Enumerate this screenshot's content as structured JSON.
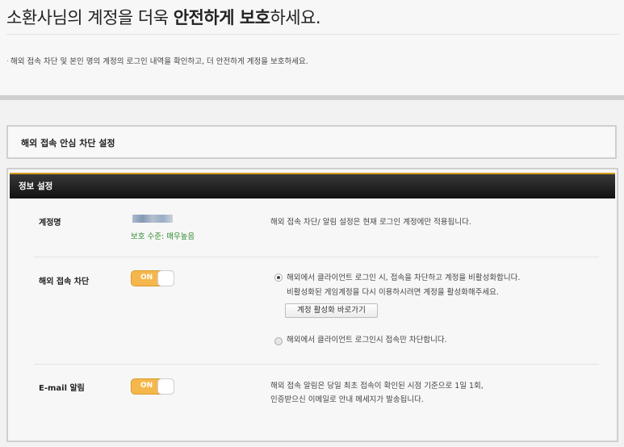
{
  "header": {
    "title_prefix": "소환사님의 계정을 더욱 ",
    "title_bold": "안전하게 보호",
    "title_suffix": "하세요.",
    "description": "해외 접속 차단 및 본인 명의 계정의 로그인 내역을 확인하고, 더 안전하게 계정을 보호하세요."
  },
  "section": {
    "title": "해외 접속 안심 차단 설정"
  },
  "panel": {
    "header": "정보 설정",
    "account": {
      "label": "계정명",
      "protection": "보호 수준: 매우높음",
      "note": "해외 접속 차단/ 알림 설정은 현재 로그인 계정에만 적용됩니다."
    },
    "block": {
      "label": "해외 접속 차단",
      "toggle": "ON",
      "option1": "해외에서 클라이언트 로그인 시, 접속을 차단하고 계정을 비활성화합니다.",
      "option1_sub": "비활성화된 게임계정을 다시 이용하시려면 계정을 활성화해주세요.",
      "activate_button": "계정 활성화 바로가기",
      "option2": "해외에서 클라이언트 로그인시 접속만 차단합니다."
    },
    "email": {
      "label": "E-mail 알림",
      "toggle": "ON",
      "note_line1": "해외 접속 알림은 당일 최초 접속이 확인된 시점 기준으로 1일 1회,",
      "note_line2": "인증받으신 이메일로 안내 메세지가 발송됩니다."
    }
  },
  "colors": {
    "toggle_on": "#f5b74c",
    "protection_text": "#2e8b2e",
    "header_accent": "#d6a024"
  }
}
